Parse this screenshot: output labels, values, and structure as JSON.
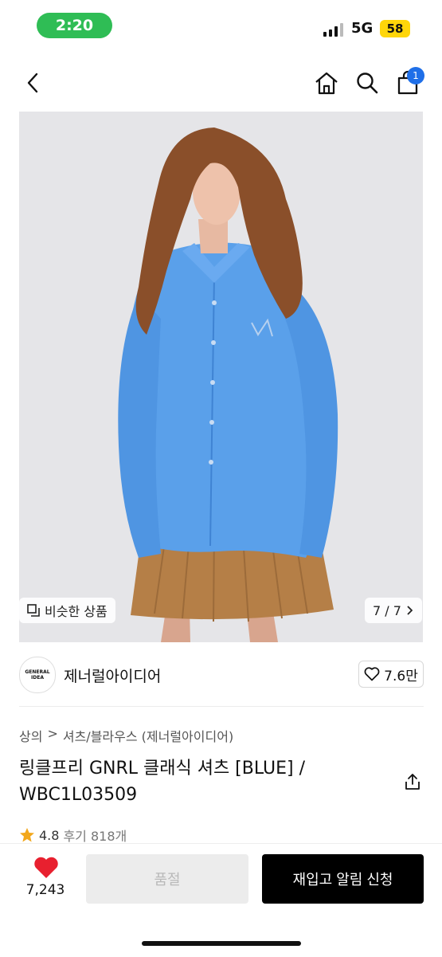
{
  "status_bar": {
    "time": "2:20",
    "network": "5G",
    "battery": "58"
  },
  "header": {
    "cart_count": "1"
  },
  "gallery": {
    "similar_label": "비슷한 상품",
    "counter": "7 / 7"
  },
  "brand": {
    "logo_text": "GENERAL IDEA",
    "name": "제너럴아이디어",
    "likes": "7.6만"
  },
  "breadcrumb": [
    "상의",
    "셔츠/블라우스 (제너럴아이디어)"
  ],
  "product": {
    "title": "링클프리 GNRL 클래식 셔츠 [BLUE] / WBC1L03509"
  },
  "rating": {
    "score": "4.8",
    "review_label": "후기 818개"
  },
  "bottom_bar": {
    "wish_count": "7,243",
    "soldout_label": "품절",
    "restock_label": "재입고 알림 신청"
  },
  "colors": {
    "accent_badge": "#1f6fe8",
    "status_green": "#2fbd55",
    "heart": "#e8202f",
    "primary_button": "#000000",
    "disabled_button": "#ececec"
  },
  "icons": [
    "back-icon",
    "home-icon",
    "search-icon",
    "cart-icon",
    "similar-icon",
    "chevron-right-icon",
    "heart-outline-icon",
    "share-icon",
    "star-icon",
    "heart-filled-icon"
  ]
}
